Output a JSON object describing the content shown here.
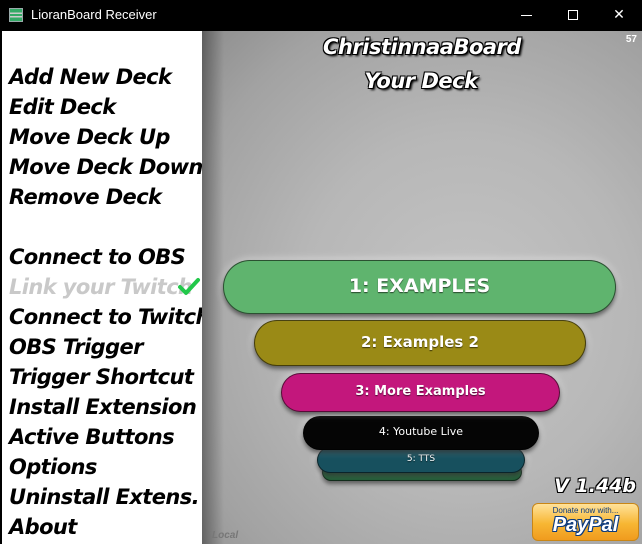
{
  "window": {
    "title": "LioranBoard Receiver",
    "controls": {
      "minimize": "minimize",
      "maximize": "maximize",
      "close": "✕"
    }
  },
  "sidebar": {
    "items": [
      {
        "label": "Add New Deck",
        "enabled": true
      },
      {
        "label": "Edit Deck",
        "enabled": true
      },
      {
        "label": "Move Deck Up",
        "enabled": true
      },
      {
        "label": "Move Deck Down",
        "enabled": true
      },
      {
        "label": "Remove Deck",
        "enabled": true
      },
      {
        "label": "Connect to OBS",
        "enabled": true
      },
      {
        "label": "Link your Twitch",
        "enabled": false,
        "status_icon": "check-icon"
      },
      {
        "label": "Connect to Twitch",
        "enabled": true
      },
      {
        "label": "OBS Trigger",
        "enabled": true
      },
      {
        "label": "Trigger Shortcut",
        "enabled": true
      },
      {
        "label": "Install Extension",
        "enabled": true
      },
      {
        "label": "Active Buttons",
        "enabled": true
      },
      {
        "label": "Options",
        "enabled": true
      },
      {
        "label": "Uninstall Extens.",
        "enabled": true
      },
      {
        "label": "About",
        "enabled": true
      }
    ]
  },
  "main": {
    "counter": "57",
    "title_line1": "ChristinnaaBoard",
    "title_line2": "Your Deck",
    "decks": [
      {
        "label": "1: EXAMPLES",
        "color": "#5fb46e"
      },
      {
        "label": "2: Examples 2",
        "color": "#9a8a16"
      },
      {
        "label": "3: More Examples",
        "color": "#c3177c"
      },
      {
        "label": "4: Youtube Live",
        "color": "#050505"
      },
      {
        "label": "5: TTS",
        "color": "#17505e"
      },
      {
        "label": "",
        "color": "#1f5a34"
      }
    ],
    "version": "V 1.44b",
    "status": "Local",
    "donate": {
      "top_text": "Donate now with...",
      "logo": "PayPal"
    }
  }
}
